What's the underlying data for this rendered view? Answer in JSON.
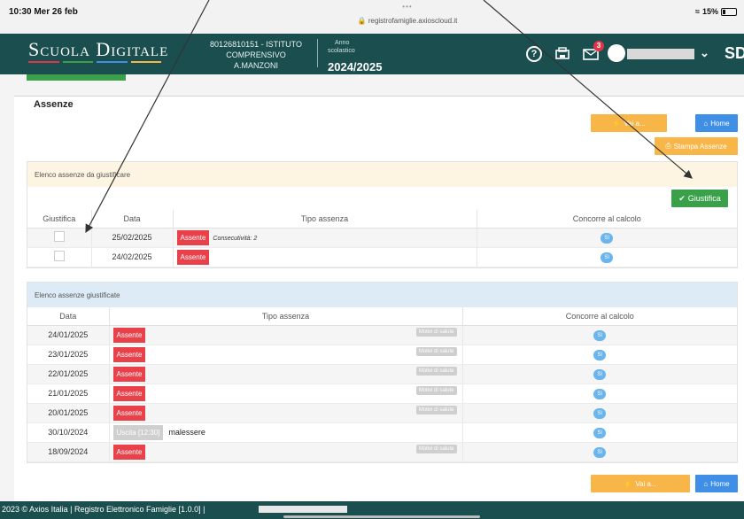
{
  "status_bar": {
    "time": "10:30  Mer 26 feb",
    "dots": "•••",
    "url": "registrofamiglie.axioscloud.it",
    "battery": "15%"
  },
  "header": {
    "brand": "Scuola Digitale",
    "school_line1": "80126810151 - ISTITUTO",
    "school_line2": "COMPRENSIVO",
    "school_line3": "A.MANZONI",
    "anno_label1": "Anno",
    "anno_label2": "scolastico",
    "anno_value": "2024/2025",
    "mail_badge": "3",
    "sd_logo": "SD",
    "brand_colors": [
      "#e0344a",
      "#3aa04a",
      "#3f8fe6",
      "#f8b648"
    ]
  },
  "page": {
    "title": "Assenze",
    "vai_a_label": "Vai a...",
    "home_label": "Home",
    "stampa_label": "Stampa Assenze"
  },
  "da_giustificare": {
    "title": "Elenco assenze da giustificare",
    "giustifica_button": "Giustifica",
    "columns": [
      "Giustifica",
      "Data",
      "Tipo assenza",
      "Concorre al calcolo"
    ],
    "rows": [
      {
        "data": "25/02/2025",
        "tipo": "Assente",
        "note": "Consecutività: 2",
        "calcolo": "Sì"
      },
      {
        "data": "24/02/2025",
        "tipo": "Assente",
        "note": "",
        "calcolo": "Sì"
      }
    ]
  },
  "giustificate": {
    "title": "Elenco assenze giustificate",
    "columns": [
      "Data",
      "Tipo assenza",
      "Concorre al calcolo"
    ],
    "rows": [
      {
        "data": "24/01/2025",
        "tipo": "Assente",
        "motivo": "Motivi di salute",
        "calcolo": "Sì"
      },
      {
        "data": "23/01/2025",
        "tipo": "Assente",
        "motivo": "Motivi di salute",
        "calcolo": "Sì"
      },
      {
        "data": "22/01/2025",
        "tipo": "Assente",
        "motivo": "Motivi di salute",
        "calcolo": "Sì"
      },
      {
        "data": "21/01/2025",
        "tipo": "Assente",
        "motivo": "Motivi di salute",
        "calcolo": "Sì"
      },
      {
        "data": "20/01/2025",
        "tipo": "Assente",
        "motivo": "Motivi di salute",
        "calcolo": "Sì"
      },
      {
        "data": "30/10/2024",
        "tipo": "Uscita [12:30]",
        "extra": "malessere",
        "calcolo": "Sì"
      },
      {
        "data": "18/09/2024",
        "tipo": "Assente",
        "motivo": "Motivi di salute",
        "calcolo": "Sì"
      }
    ]
  },
  "footer": {
    "text": "2023 © Axios Italia |  Registro Elettronico Famiglie [1.0.0] |"
  },
  "colors": {
    "header_bg": "#1b4f4f",
    "absent_red": "#e8414a",
    "giustifica_green": "#3aa04a",
    "pending_panel": "#fdf5e1",
    "justified_panel": "#dcebf5",
    "pill_blue": "#6ab5ee"
  }
}
